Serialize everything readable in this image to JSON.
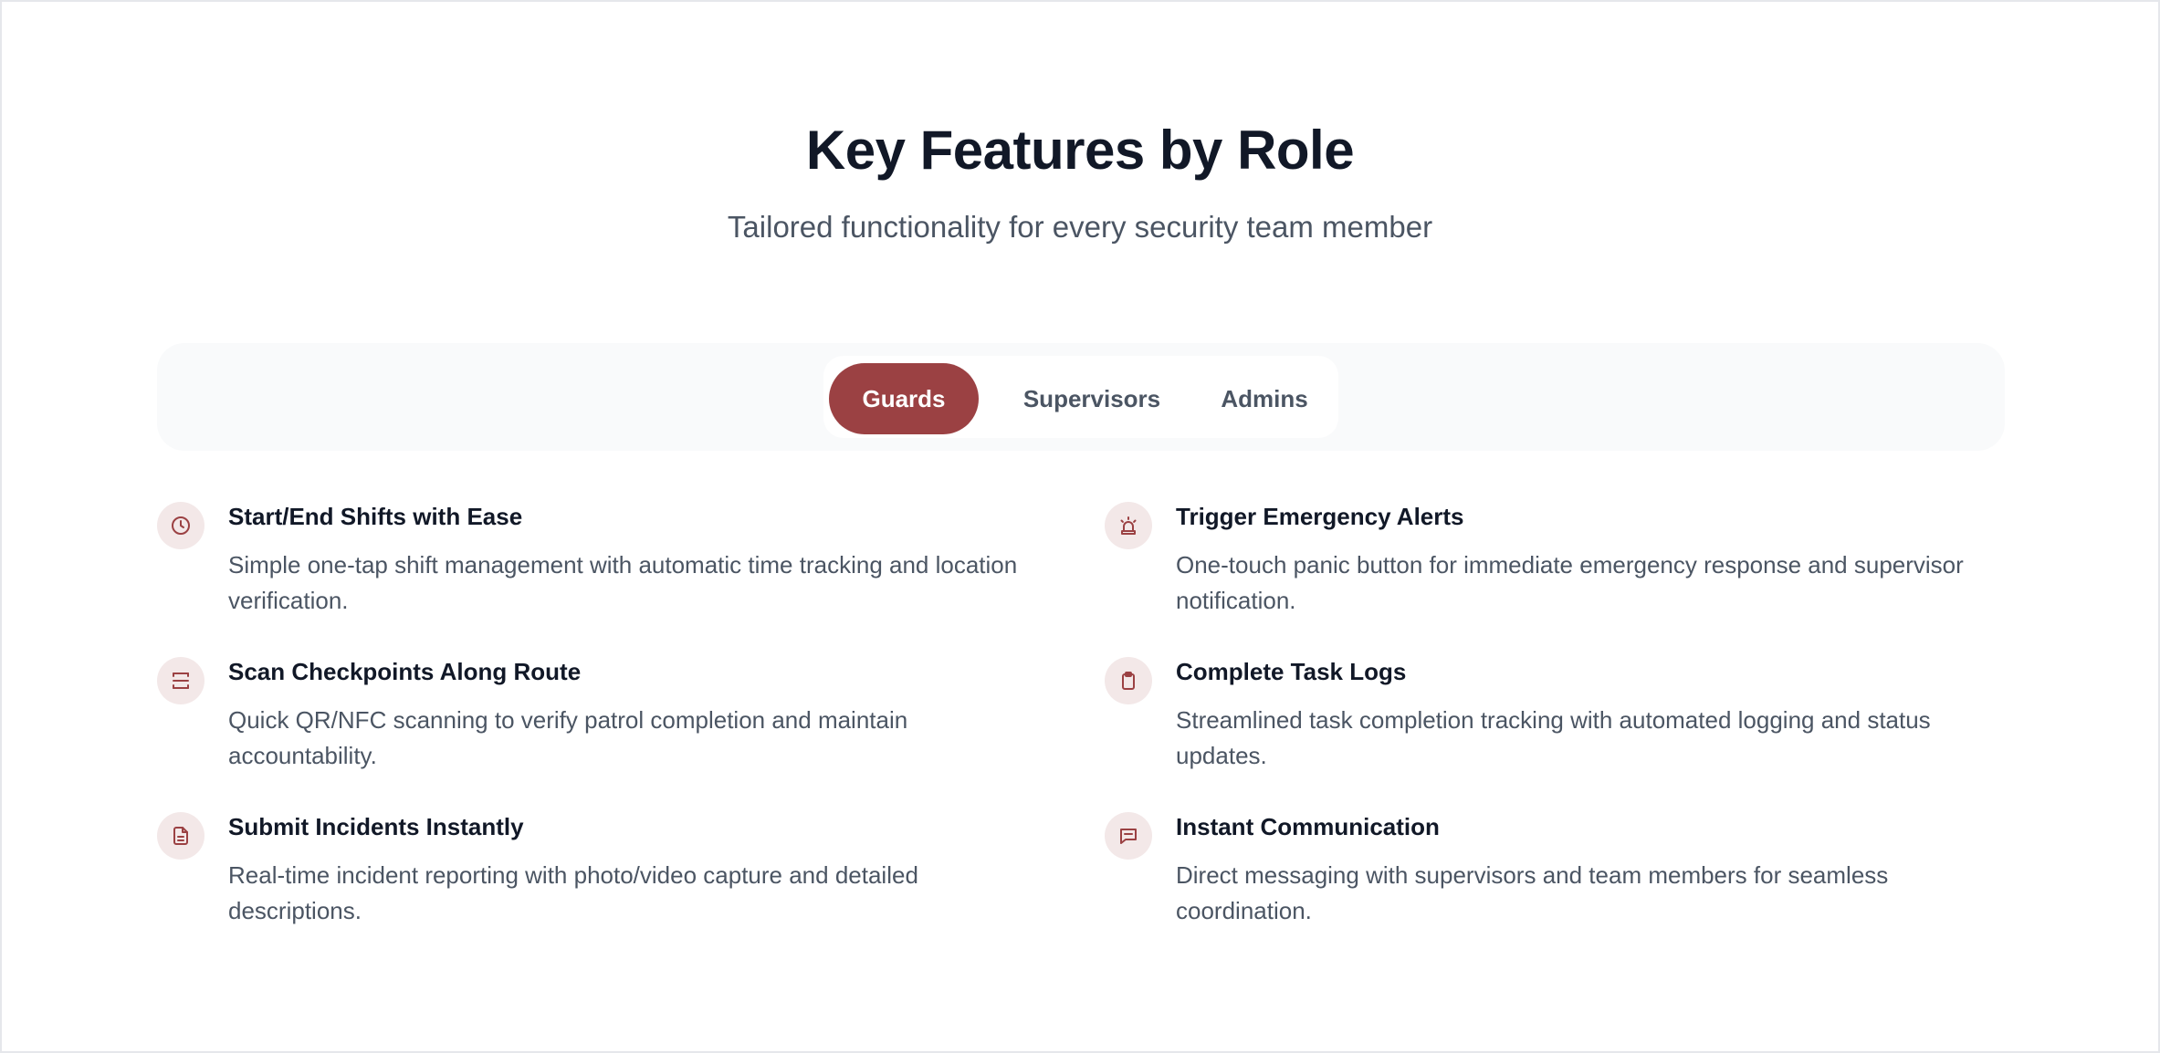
{
  "header": {
    "title": "Key Features by Role",
    "subtitle": "Tailored functionality for every security team member"
  },
  "tabs": [
    {
      "label": "Guards",
      "active": true
    },
    {
      "label": "Supervisors",
      "active": false
    },
    {
      "label": "Admins",
      "active": false
    }
  ],
  "colors": {
    "accent": "#9b4143",
    "icon_bg": "#f3e8e8",
    "tabbar_bg": "#f9fafb",
    "heading": "#111827",
    "body_text": "#4b5563"
  },
  "features": [
    {
      "icon": "clock-icon",
      "title": "Start/End Shifts with Ease",
      "description": "Simple one-tap shift management with automatic time tracking and location verification."
    },
    {
      "icon": "siren-icon",
      "title": "Trigger Emergency Alerts",
      "description": "One-touch panic button for immediate emergency response and supervisor notification."
    },
    {
      "icon": "scan-icon",
      "title": "Scan Checkpoints Along Route",
      "description": "Quick QR/NFC scanning to verify patrol completion and maintain accountability."
    },
    {
      "icon": "clipboard-icon",
      "title": "Complete Task Logs",
      "description": "Streamlined task completion tracking with automated logging and status updates."
    },
    {
      "icon": "document-icon",
      "title": "Submit Incidents Instantly",
      "description": "Real-time incident reporting with photo/video capture and detailed descriptions."
    },
    {
      "icon": "message-icon",
      "title": "Instant Communication",
      "description": "Direct messaging with supervisors and team members for seamless coordination."
    }
  ]
}
